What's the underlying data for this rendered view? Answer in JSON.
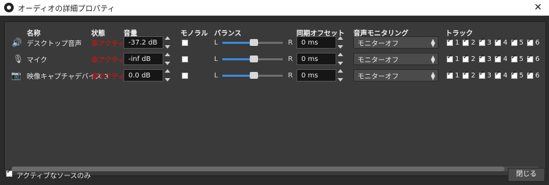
{
  "window": {
    "title": "オーディオの詳細プロパティ"
  },
  "headers": {
    "name": "名称",
    "status": "状態",
    "volume": "音量",
    "mono": "モノラル",
    "balance": "バランス",
    "sync_offset": "同期オフセット",
    "monitoring": "音声モニタリング",
    "tracks": "トラック"
  },
  "rows": [
    {
      "icon": "speaker-icon",
      "name": "デスクトップ音声",
      "status": "非アクティブ",
      "volume": "-37.2 dB",
      "mono": false,
      "balance_left": "L",
      "balance_right": "R",
      "balance_value": 0.5,
      "sync_offset": "0 ms",
      "monitoring": "モニターオフ",
      "tracks": [
        "1",
        "2",
        "3",
        "4",
        "5",
        "6"
      ],
      "tracks_checked": [
        true,
        true,
        true,
        true,
        true,
        true
      ]
    },
    {
      "icon": "microphone-icon",
      "name": "マイク",
      "status": "非アクティブ",
      "volume": "-inf dB",
      "mono": false,
      "balance_left": "L",
      "balance_right": "R",
      "balance_value": 0.5,
      "sync_offset": "0 ms",
      "monitoring": "モニターオフ",
      "tracks": [
        "1",
        "2",
        "3",
        "4",
        "5",
        "6"
      ],
      "tracks_checked": [
        true,
        true,
        true,
        true,
        true,
        true
      ]
    },
    {
      "icon": "camera-icon",
      "name": "映像キャプチャデバイス 3",
      "status": "非アクティブ",
      "volume": "0.0 dB",
      "mono": false,
      "balance_left": "L",
      "balance_right": "R",
      "balance_value": 0.5,
      "sync_offset": "0 ms",
      "monitoring": "モニターオフ",
      "tracks": [
        "1",
        "2",
        "3",
        "4",
        "5",
        "6"
      ],
      "tracks_checked": [
        true,
        true,
        true,
        true,
        true,
        true
      ]
    }
  ],
  "footer": {
    "active_only_label": "アクティブなソースのみ",
    "active_only_checked": true,
    "close_button": "閉じる"
  },
  "colors": {
    "background": "#2b2b2b",
    "panel": "#3a3a3a",
    "accent": "#3b8bd9",
    "status_red": "#b11c1c"
  }
}
